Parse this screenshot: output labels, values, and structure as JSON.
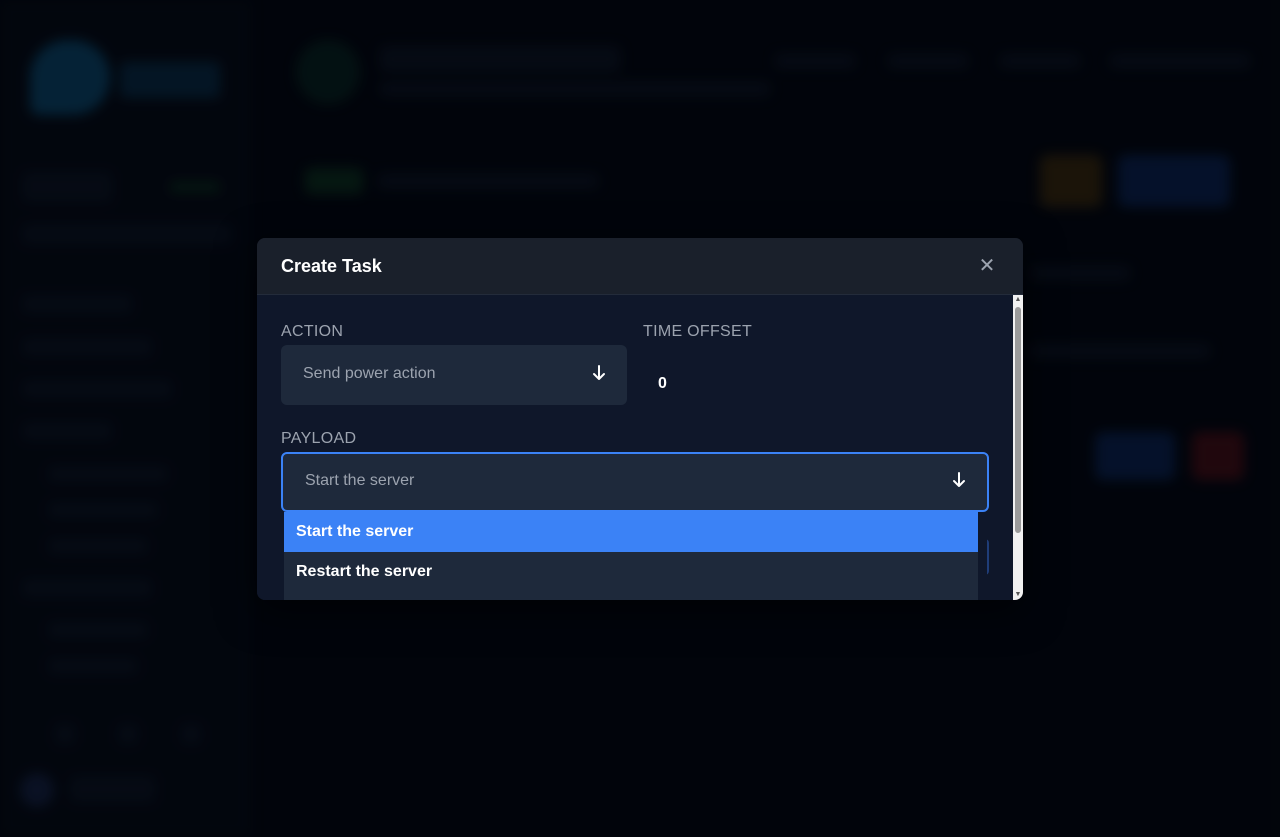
{
  "modal": {
    "title": "Create Task",
    "close_glyph": "✕",
    "action": {
      "label": "ACTION",
      "value": "Send power action",
      "icon": "arrow-down-icon"
    },
    "time_offset": {
      "label": "TIME OFFSET",
      "value": "0"
    },
    "payload": {
      "label": "PAYLOAD",
      "value": "Start the server",
      "icon": "arrow-down-icon",
      "options": [
        {
          "label": "Start the server",
          "selected": true
        },
        {
          "label": "Restart the server",
          "selected": false
        }
      ]
    },
    "scrollbar": {
      "up_glyph": "▲",
      "down_glyph": "▼"
    }
  },
  "colors": {
    "accent": "#3b82f6",
    "modal_bg": "#0f172a",
    "header_bg": "#1a202b",
    "field_bg": "#1e293b"
  }
}
